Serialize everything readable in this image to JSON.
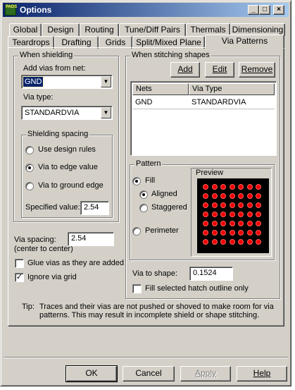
{
  "window": {
    "title": "Options",
    "app_icon_text": "PADS"
  },
  "tabs_back": [
    "Global",
    "Design",
    "Routing",
    "Tune/Diff Pairs",
    "Thermals",
    "Dimensioning"
  ],
  "tabs_front": [
    "Teardrops",
    "Drafting",
    "Grids",
    "Split/Mixed Plane",
    "Via Patterns"
  ],
  "active_tab": "Via Patterns",
  "shielding": {
    "group_title": "When shielding",
    "add_vias_label": "Add vias from net:",
    "net_value": "GND",
    "via_type_label": "Via type:",
    "via_type_value": "STANDARDVIA",
    "spacing_group_title": "Shielding spacing",
    "options": [
      "Use design rules",
      "Via to edge value",
      "Via to ground edge"
    ],
    "selected_option": "Via to edge value",
    "specified_value_label": "Specified value:",
    "specified_value": "2.54"
  },
  "via_spacing": {
    "label_line1": "Via spacing:",
    "label_line2": "(center to center)",
    "value": "2.54"
  },
  "glue_vias": {
    "label": "Glue vias as they are added",
    "checked": false
  },
  "ignore_grid": {
    "label": "Ignore via grid",
    "checked": true
  },
  "stitching": {
    "group_title": "When stitching shapes",
    "add_label": "Add",
    "edit_label": "Edit",
    "remove_label": "Remove",
    "columns": [
      "Nets",
      "Via Type"
    ],
    "rows": [
      {
        "net": "GND",
        "via_type": "STANDARDVIA"
      }
    ],
    "pattern": {
      "group_title": "Pattern",
      "fill_label": "Fill",
      "aligned_label": "Aligned",
      "staggered_label": "Staggered",
      "perimeter_label": "Perimeter",
      "selected": "Fill",
      "fill_mode": "Aligned",
      "preview_label": "Preview",
      "preview_grid": {
        "rows": 7,
        "cols": 7
      },
      "preview_bg": "#000000",
      "via_color": "#ee0000"
    },
    "via_to_shape_label": "Via to shape:",
    "via_to_shape_value": "0.1524",
    "fill_hatch_label": "Fill selected hatch outline only",
    "fill_hatch_checked": false
  },
  "tip": {
    "prefix": "Tip:",
    "line1": "Traces and their vias are not pushed or shoved to make room for via",
    "line2": "patterns. This may result in incomplete shield or shape stitching."
  },
  "buttons": {
    "ok": "OK",
    "cancel": "Cancel",
    "apply": "Apply",
    "help": "Help"
  }
}
